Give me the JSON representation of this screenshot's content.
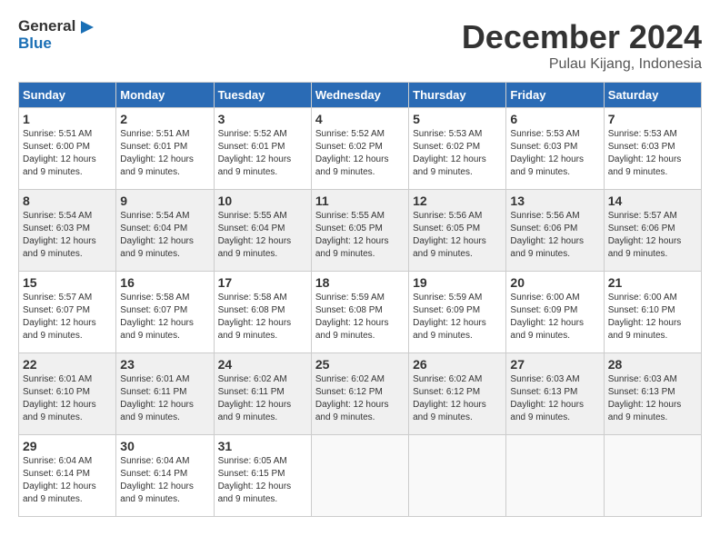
{
  "logo": {
    "line1": "General",
    "line2": "Blue"
  },
  "title": "December 2024",
  "subtitle": "Pulau Kijang, Indonesia",
  "headers": [
    "Sunday",
    "Monday",
    "Tuesday",
    "Wednesday",
    "Thursday",
    "Friday",
    "Saturday"
  ],
  "weeks": [
    [
      {
        "day": "1",
        "sunrise": "5:51 AM",
        "sunset": "6:00 PM",
        "daylight": "12 hours and 9 minutes."
      },
      {
        "day": "2",
        "sunrise": "5:51 AM",
        "sunset": "6:01 PM",
        "daylight": "12 hours and 9 minutes."
      },
      {
        "day": "3",
        "sunrise": "5:52 AM",
        "sunset": "6:01 PM",
        "daylight": "12 hours and 9 minutes."
      },
      {
        "day": "4",
        "sunrise": "5:52 AM",
        "sunset": "6:02 PM",
        "daylight": "12 hours and 9 minutes."
      },
      {
        "day": "5",
        "sunrise": "5:53 AM",
        "sunset": "6:02 PM",
        "daylight": "12 hours and 9 minutes."
      },
      {
        "day": "6",
        "sunrise": "5:53 AM",
        "sunset": "6:03 PM",
        "daylight": "12 hours and 9 minutes."
      },
      {
        "day": "7",
        "sunrise": "5:53 AM",
        "sunset": "6:03 PM",
        "daylight": "12 hours and 9 minutes."
      }
    ],
    [
      {
        "day": "8",
        "sunrise": "5:54 AM",
        "sunset": "6:03 PM",
        "daylight": "12 hours and 9 minutes."
      },
      {
        "day": "9",
        "sunrise": "5:54 AM",
        "sunset": "6:04 PM",
        "daylight": "12 hours and 9 minutes."
      },
      {
        "day": "10",
        "sunrise": "5:55 AM",
        "sunset": "6:04 PM",
        "daylight": "12 hours and 9 minutes."
      },
      {
        "day": "11",
        "sunrise": "5:55 AM",
        "sunset": "6:05 PM",
        "daylight": "12 hours and 9 minutes."
      },
      {
        "day": "12",
        "sunrise": "5:56 AM",
        "sunset": "6:05 PM",
        "daylight": "12 hours and 9 minutes."
      },
      {
        "day": "13",
        "sunrise": "5:56 AM",
        "sunset": "6:06 PM",
        "daylight": "12 hours and 9 minutes."
      },
      {
        "day": "14",
        "sunrise": "5:57 AM",
        "sunset": "6:06 PM",
        "daylight": "12 hours and 9 minutes."
      }
    ],
    [
      {
        "day": "15",
        "sunrise": "5:57 AM",
        "sunset": "6:07 PM",
        "daylight": "12 hours and 9 minutes."
      },
      {
        "day": "16",
        "sunrise": "5:58 AM",
        "sunset": "6:07 PM",
        "daylight": "12 hours and 9 minutes."
      },
      {
        "day": "17",
        "sunrise": "5:58 AM",
        "sunset": "6:08 PM",
        "daylight": "12 hours and 9 minutes."
      },
      {
        "day": "18",
        "sunrise": "5:59 AM",
        "sunset": "6:08 PM",
        "daylight": "12 hours and 9 minutes."
      },
      {
        "day": "19",
        "sunrise": "5:59 AM",
        "sunset": "6:09 PM",
        "daylight": "12 hours and 9 minutes."
      },
      {
        "day": "20",
        "sunrise": "6:00 AM",
        "sunset": "6:09 PM",
        "daylight": "12 hours and 9 minutes."
      },
      {
        "day": "21",
        "sunrise": "6:00 AM",
        "sunset": "6:10 PM",
        "daylight": "12 hours and 9 minutes."
      }
    ],
    [
      {
        "day": "22",
        "sunrise": "6:01 AM",
        "sunset": "6:10 PM",
        "daylight": "12 hours and 9 minutes."
      },
      {
        "day": "23",
        "sunrise": "6:01 AM",
        "sunset": "6:11 PM",
        "daylight": "12 hours and 9 minutes."
      },
      {
        "day": "24",
        "sunrise": "6:02 AM",
        "sunset": "6:11 PM",
        "daylight": "12 hours and 9 minutes."
      },
      {
        "day": "25",
        "sunrise": "6:02 AM",
        "sunset": "6:12 PM",
        "daylight": "12 hours and 9 minutes."
      },
      {
        "day": "26",
        "sunrise": "6:02 AM",
        "sunset": "6:12 PM",
        "daylight": "12 hours and 9 minutes."
      },
      {
        "day": "27",
        "sunrise": "6:03 AM",
        "sunset": "6:13 PM",
        "daylight": "12 hours and 9 minutes."
      },
      {
        "day": "28",
        "sunrise": "6:03 AM",
        "sunset": "6:13 PM",
        "daylight": "12 hours and 9 minutes."
      }
    ],
    [
      {
        "day": "29",
        "sunrise": "6:04 AM",
        "sunset": "6:14 PM",
        "daylight": "12 hours and 9 minutes."
      },
      {
        "day": "30",
        "sunrise": "6:04 AM",
        "sunset": "6:14 PM",
        "daylight": "12 hours and 9 minutes."
      },
      {
        "day": "31",
        "sunrise": "6:05 AM",
        "sunset": "6:15 PM",
        "daylight": "12 hours and 9 minutes."
      },
      null,
      null,
      null,
      null
    ]
  ],
  "labels": {
    "sunrise_prefix": "Sunrise: ",
    "sunset_prefix": "Sunset: ",
    "daylight_prefix": "Daylight: "
  }
}
